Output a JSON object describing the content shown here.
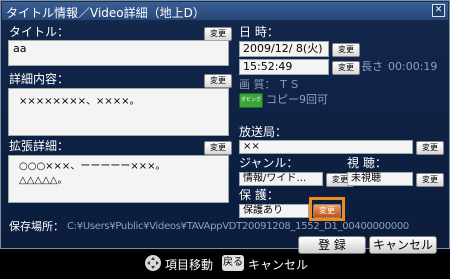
{
  "dialog": {
    "title": "タイトル情報／Video詳細（地上D）",
    "close_glyph": "✕"
  },
  "change_label": "変更",
  "left": {
    "title_label": "タイトル：",
    "title_value": "aa",
    "detail_label": "詳細内容：",
    "detail_value": "××××××××、××××。",
    "ext_label": "拡張詳細：",
    "ext_value_line1": "○○○×××、ーーーーー×××。",
    "ext_value_line2": "△△△△△。"
  },
  "right": {
    "datetime_label": "日 時：",
    "date_value": "2009/12/ 8(火)",
    "time_value": "15:52:49",
    "length_label": "長さ",
    "length_value": "00:00:19",
    "quality_label": "画 質：",
    "quality_value": "ＴＳ",
    "dubbing_badge": "ダビング10",
    "copy_text": "コピー9回可",
    "station_label": "放送局：",
    "station_value": "××",
    "genre_label": "ジャンル：",
    "genre_value": "情報/ワイド…",
    "viewing_label": "視 聴：",
    "viewing_value": "未視聴",
    "protect_label": "保 護：",
    "protect_value": "保護あり",
    "protect_change_label": "変更"
  },
  "save_location_label": "保存場所：",
  "save_location_value": "C:¥Users¥Public¥Videos¥TAVAppVDT20091208_1552_D1_00400000000",
  "buttons": {
    "register": "登 録",
    "cancel": "キャンセル"
  },
  "footer": {
    "move_label": "項目移動",
    "back_key": "戻る",
    "back_label": "キャンセル"
  }
}
